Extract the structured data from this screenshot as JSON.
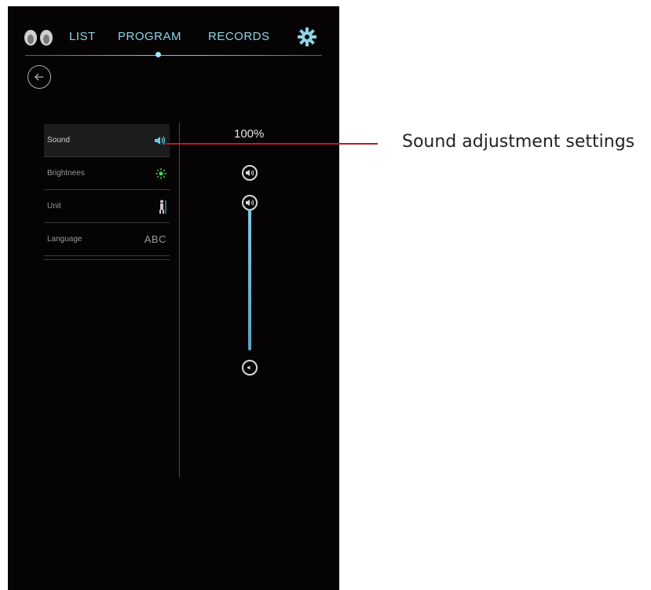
{
  "nav": {
    "tabs": [
      {
        "label": "LIST"
      },
      {
        "label": "PROGRAM"
      },
      {
        "label": "RECORDS"
      }
    ],
    "active_tab": "PROGRAM"
  },
  "settings": {
    "items": [
      {
        "label": "Sound",
        "icon": "speaker-icon",
        "active": true
      },
      {
        "label": "Brightnees",
        "icon": "sun-icon"
      },
      {
        "label": "Unit",
        "icon": "person-icon"
      },
      {
        "label": "Language",
        "icon_text": "ABC"
      }
    ]
  },
  "volume": {
    "percent_label": "100%",
    "level": 1.0
  },
  "annotation": {
    "text": "Sound adjustment settings",
    "color": "#c0181f"
  },
  "colors": {
    "accent": "#69c9e0",
    "background": "#050303"
  }
}
